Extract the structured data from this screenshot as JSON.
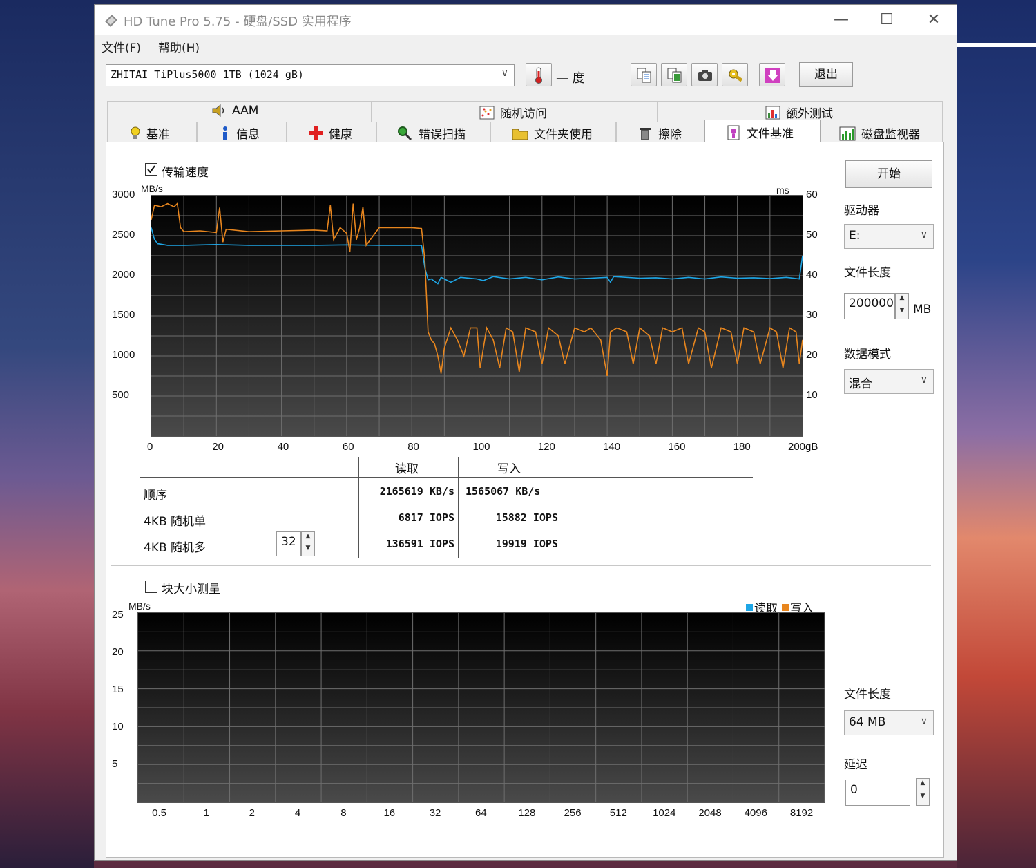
{
  "window": {
    "title": "HD Tune Pro 5.75 - 硬盘/SSD 实用程序",
    "minimize": "—",
    "maximize": "☐",
    "close": "✕"
  },
  "menu": {
    "file": "文件(F)",
    "help": "帮助(H)"
  },
  "toolbar": {
    "drive": "ZHITAI TiPlus5000 1TB (1024 gB)",
    "temperature": "— 度",
    "exit": "退出"
  },
  "tabs_top": [
    "AAM",
    "随机访问",
    "额外测试"
  ],
  "tabs_bottom": [
    "基准",
    "信息",
    "健康",
    "错误扫描",
    "文件夹使用",
    "擦除",
    "文件基准",
    "磁盘监视器"
  ],
  "active_tab": "文件基准",
  "transfer": {
    "checkbox_label": "传输速度",
    "checked": true,
    "unit_left": "MB/s",
    "unit_right": "ms",
    "y_left_ticks": [
      "3000",
      "2500",
      "2000",
      "1500",
      "1000",
      "500"
    ],
    "y_right_ticks": [
      "60",
      "50",
      "40",
      "30",
      "20",
      "10"
    ],
    "x_ticks": [
      "0",
      "20",
      "40",
      "60",
      "80",
      "100",
      "120",
      "140",
      "160",
      "180",
      "200gB"
    ]
  },
  "results": {
    "col_read": "读取",
    "col_write": "写入",
    "rows": [
      {
        "label": "顺序",
        "read": "2165619 KB/s",
        "write": "1565067 KB/s"
      },
      {
        "label": "4KB 随机单",
        "read": "6817 IOPS",
        "write": "15882 IOPS"
      },
      {
        "label": "4KB 随机多",
        "read": "136591 IOPS",
        "write": "19919 IOPS"
      }
    ],
    "queue_depth": "32"
  },
  "side": {
    "start": "开始",
    "drive_label": "驱动器",
    "drive_value": "E:",
    "file_length_label": "文件长度",
    "file_length_value": "200000",
    "file_length_unit": "MB",
    "data_mode_label": "数据模式",
    "data_mode_value": "混合",
    "file_length2_label": "文件长度",
    "file_length2_value": "64 MB",
    "delay_label": "延迟",
    "delay_value": "0"
  },
  "block": {
    "checkbox_label": "块大小测量",
    "checked": false,
    "unit": "MB/s",
    "y_ticks": [
      "25",
      "20",
      "15",
      "10",
      "5"
    ],
    "x_ticks": [
      "0.5",
      "1",
      "2",
      "4",
      "8",
      "16",
      "32",
      "64",
      "128",
      "256",
      "512",
      "1024",
      "2048",
      "4096",
      "8192"
    ],
    "legend_read": "读取",
    "legend_write": "写入"
  },
  "colors": {
    "read": "#1ea6e6",
    "write": "#e8861e",
    "grid": "#6e6e6e"
  },
  "chart_data": {
    "type": "line",
    "title": "",
    "xlabel": "gB",
    "ylabel": "MB/s",
    "xlim": [
      0,
      200
    ],
    "ylim": [
      0,
      3000
    ],
    "y2lim": [
      0,
      60
    ],
    "grid": true,
    "series": [
      {
        "name": "读取",
        "points": [
          [
            0,
            2600
          ],
          [
            1,
            2450
          ],
          [
            2,
            2400
          ],
          [
            5,
            2380
          ],
          [
            10,
            2380
          ],
          [
            20,
            2390
          ],
          [
            30,
            2380
          ],
          [
            40,
            2380
          ],
          [
            50,
            2380
          ],
          [
            60,
            2385
          ],
          [
            70,
            2380
          ],
          [
            75,
            2380
          ],
          [
            80,
            2380
          ],
          [
            83,
            2380
          ],
          [
            84,
            2100
          ],
          [
            85,
            1950
          ],
          [
            86,
            1960
          ],
          [
            88,
            1900
          ],
          [
            89,
            1980
          ],
          [
            90,
            1960
          ],
          [
            92,
            1920
          ],
          [
            95,
            1980
          ],
          [
            100,
            1960
          ],
          [
            102,
            1940
          ],
          [
            105,
            1990
          ],
          [
            110,
            1960
          ],
          [
            115,
            1980
          ],
          [
            120,
            1950
          ],
          [
            125,
            1985
          ],
          [
            130,
            1960
          ],
          [
            135,
            1970
          ],
          [
            140,
            1980
          ],
          [
            141,
            1920
          ],
          [
            142,
            1990
          ],
          [
            150,
            1970
          ],
          [
            155,
            1975
          ],
          [
            160,
            1960
          ],
          [
            165,
            1980
          ],
          [
            170,
            1960
          ],
          [
            175,
            1985
          ],
          [
            180,
            1970
          ],
          [
            185,
            1975
          ],
          [
            190,
            1965
          ],
          [
            195,
            1980
          ],
          [
            199,
            1960
          ],
          [
            200,
            2250
          ]
        ]
      },
      {
        "name": "写入",
        "points": [
          [
            0,
            2700
          ],
          [
            1,
            2880
          ],
          [
            3,
            2860
          ],
          [
            5,
            2900
          ],
          [
            7,
            2860
          ],
          [
            8,
            2900
          ],
          [
            9,
            2600
          ],
          [
            10,
            2550
          ],
          [
            15,
            2560
          ],
          [
            20,
            2540
          ],
          [
            21,
            2850
          ],
          [
            22,
            2420
          ],
          [
            23,
            2580
          ],
          [
            30,
            2550
          ],
          [
            40,
            2560
          ],
          [
            50,
            2570
          ],
          [
            54,
            2560
          ],
          [
            55,
            2880
          ],
          [
            56,
            2450
          ],
          [
            58,
            2600
          ],
          [
            60,
            2530
          ],
          [
            61,
            2300
          ],
          [
            62,
            2900
          ],
          [
            63,
            2450
          ],
          [
            64,
            2600
          ],
          [
            65,
            2860
          ],
          [
            66,
            2380
          ],
          [
            70,
            2600
          ],
          [
            80,
            2600
          ],
          [
            83,
            2590
          ],
          [
            84,
            2200
          ],
          [
            85,
            1300
          ],
          [
            86,
            1200
          ],
          [
            87,
            1150
          ],
          [
            88,
            1000
          ],
          [
            89,
            780
          ],
          [
            90,
            1100
          ],
          [
            92,
            1350
          ],
          [
            94,
            1200
          ],
          [
            96,
            1000
          ],
          [
            98,
            1350
          ],
          [
            100,
            1350
          ],
          [
            101,
            850
          ],
          [
            103,
            1350
          ],
          [
            105,
            1200
          ],
          [
            107,
            850
          ],
          [
            109,
            1350
          ],
          [
            111,
            1300
          ],
          [
            113,
            800
          ],
          [
            115,
            1350
          ],
          [
            118,
            1300
          ],
          [
            120,
            900
          ],
          [
            122,
            1350
          ],
          [
            125,
            1250
          ],
          [
            127,
            900
          ],
          [
            130,
            1350
          ],
          [
            133,
            1300
          ],
          [
            135,
            1350
          ],
          [
            138,
            1200
          ],
          [
            140,
            750
          ],
          [
            141,
            1300
          ],
          [
            143,
            1350
          ],
          [
            146,
            1300
          ],
          [
            148,
            900
          ],
          [
            150,
            1350
          ],
          [
            153,
            1250
          ],
          [
            155,
            900
          ],
          [
            157,
            1350
          ],
          [
            160,
            1300
          ],
          [
            163,
            1350
          ],
          [
            165,
            900
          ],
          [
            168,
            1350
          ],
          [
            170,
            1300
          ],
          [
            172,
            850
          ],
          [
            175,
            1350
          ],
          [
            178,
            1300
          ],
          [
            180,
            900
          ],
          [
            182,
            1350
          ],
          [
            185,
            1300
          ],
          [
            187,
            900
          ],
          [
            190,
            1350
          ],
          [
            192,
            1300
          ],
          [
            194,
            850
          ],
          [
            196,
            1350
          ],
          [
            198,
            1300
          ],
          [
            199,
            900
          ],
          [
            200,
            1200
          ]
        ]
      }
    ]
  }
}
